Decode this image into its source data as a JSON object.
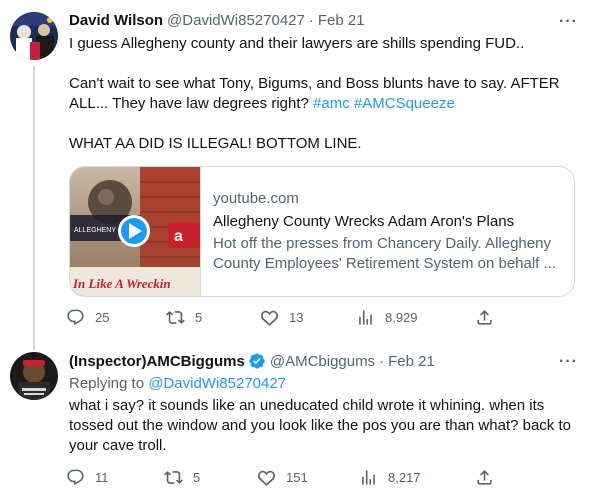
{
  "tweets": [
    {
      "name": "David Wilson",
      "handle": "@DavidWi85270427",
      "dot": "·",
      "time": "Feb 21",
      "more": "···",
      "paragraph1": "I guess Allegheny county and their lawyers are shills spending FUD..",
      "paragraph2_text": "Can't wait to see what Tony, Bigums, and Boss blunts have to say. AFTER ALL... They have law degrees right? ",
      "hashtag1": "#amc",
      "hashtag2": "#AMCSqueeze",
      "paragraph3": "WHAT AA DID IS ILLEGAL! BOTTOM LINE.",
      "card": {
        "domain": "youtube.com",
        "title": "Allegheny County Wrecks Adam Aron's Plans",
        "description": "Hot off the presses from Chancery Daily. Allegheny County Employees' Retirement System on behalf ...",
        "thumb_caption": "In Like A Wreckin",
        "thumb_label": "ALLEGHENY COUNTY",
        "thumb_logo": "a"
      },
      "replies": "25",
      "retweets": "5",
      "likes": "13",
      "views": "8,929"
    },
    {
      "name": "(Inspector)AMCBiggums",
      "handle": "@AMCbiggums",
      "dot": "·",
      "time": "Feb 21",
      "more": "···",
      "replying_prefix": "Replying to ",
      "replying_to": "@DavidWi85270427",
      "text": "what i say? it sounds like an uneducated child wrote it whining. when its tossed out the window and you look like the pos you are than what? back to your cave troll.",
      "replies": "11",
      "retweets": "5",
      "likes": "151",
      "views": "8,217"
    }
  ],
  "colors": {
    "accent": "#1d9bf0",
    "muted": "#536471",
    "text": "#0f1419",
    "border": "#cfd9de"
  },
  "icons": [
    "reply-icon",
    "retweet-icon",
    "like-icon",
    "views-icon",
    "share-icon",
    "verified-badge-icon",
    "play-icon",
    "more-icon"
  ]
}
